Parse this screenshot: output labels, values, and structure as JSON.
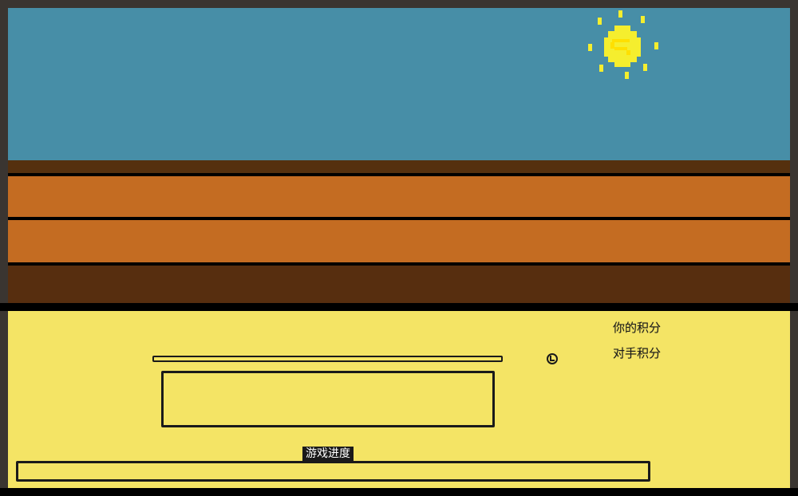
{
  "scene": {
    "sky_color": "#478ea7",
    "lane_color": "#c46c22",
    "dirt_color": "#572e0f",
    "sun_color": "#f5ee2e",
    "sun_icon": "sun-icon"
  },
  "panel": {
    "background_color": "#f4e465",
    "timer": {
      "icon": "clock-icon",
      "fill_fraction": 0
    },
    "answer_input": {
      "value": ""
    },
    "scores": {
      "you_label": "你的积分",
      "opponent_label": "对手积分"
    },
    "progress": {
      "label": "游戏进度",
      "fill_fraction": 0
    }
  }
}
